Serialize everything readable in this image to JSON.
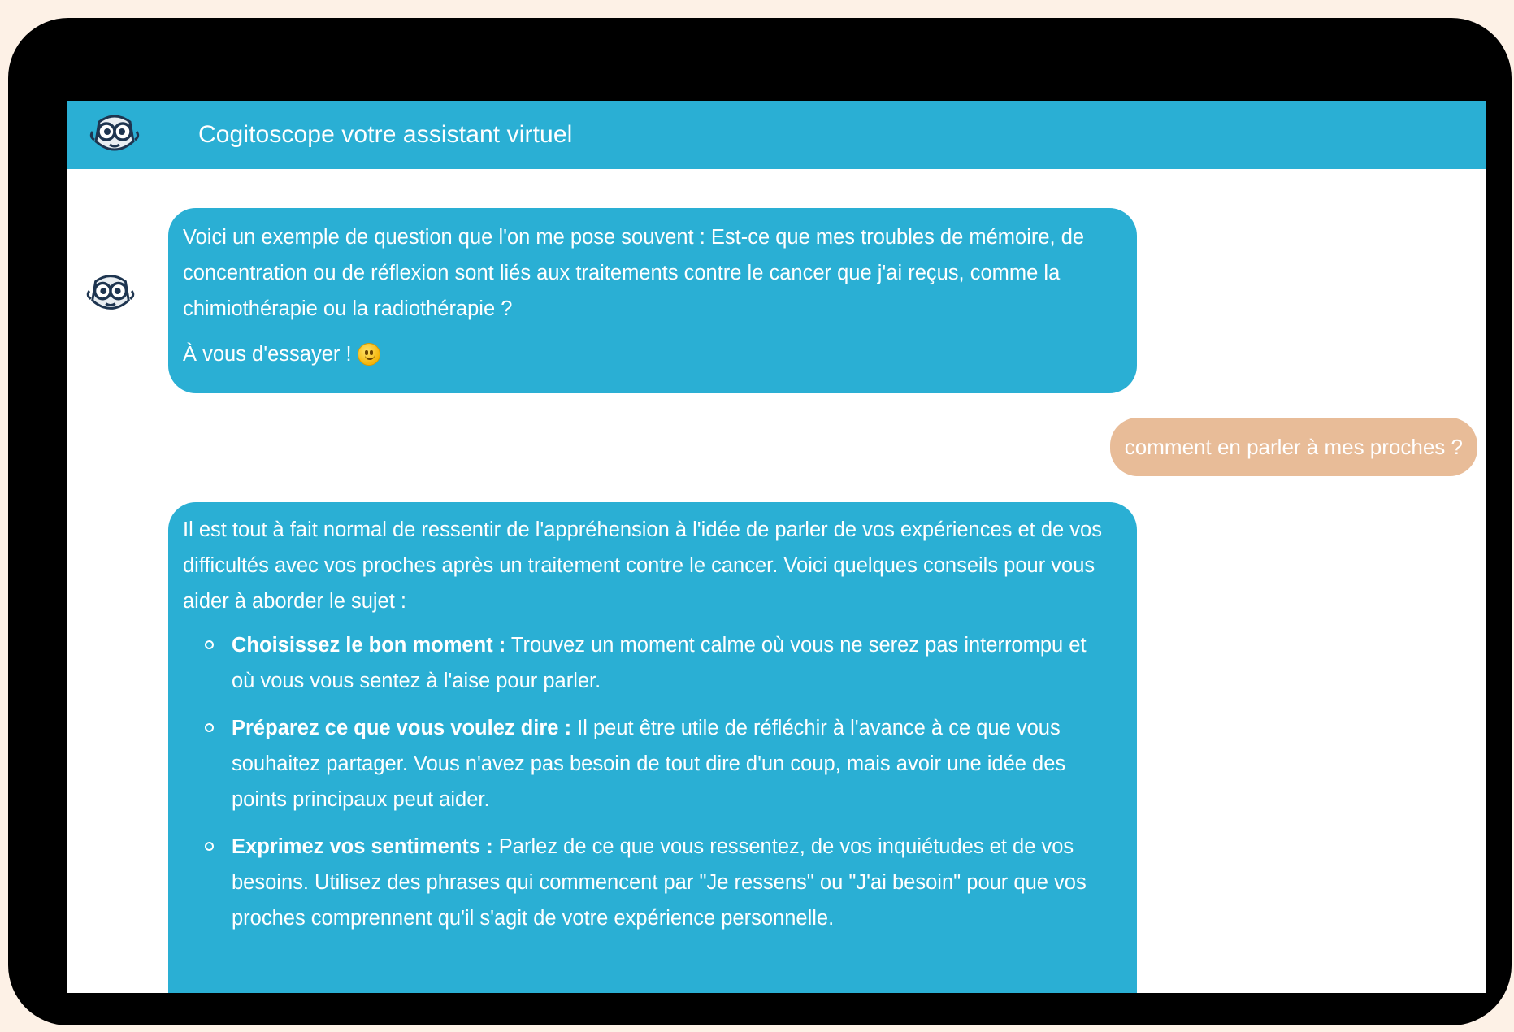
{
  "colors": {
    "page_background": "#fdf1e6",
    "device_frame": "#000000",
    "header_background": "#2aafd4",
    "bot_bubble": "#2aafd4",
    "user_bubble": "#e8bc98",
    "text_on_color": "#ffffff"
  },
  "header": {
    "title": "Cogitoscope votre assistant virtuel",
    "avatar_icon": "robot-owl-icon"
  },
  "messages": {
    "bot_intro": {
      "line1": "Voici un exemple de question que l'on me pose souvent : Est-ce que mes troubles de mémoire, de concentration ou de réflexion sont liés aux traitements contre le cancer que j'ai reçus, comme la chimiothérapie ou la radiothérapie ?",
      "line2": "À vous d'essayer !",
      "emoji": "smiley-icon"
    },
    "user_1": {
      "text": "comment en parler à mes proches ?"
    },
    "bot_reply": {
      "intro": "Il est tout à fait normal de ressentir de l'appréhension à l'idée de parler de vos expériences et de vos difficultés avec vos proches après un traitement contre le cancer. Voici quelques conseils pour vous aider à aborder le sujet :",
      "tips": [
        {
          "title": "Choisissez le bon moment :",
          "text": "Trouvez un moment calme où vous ne serez pas interrompu et où vous vous sentez à l'aise pour parler."
        },
        {
          "title": "Préparez ce que vous voulez dire :",
          "text": "Il peut être utile de réfléchir à l'avance à ce que vous souhaitez partager. Vous n'avez pas besoin de tout dire d'un coup, mais avoir une idée des points principaux peut aider."
        },
        {
          "title": "Exprimez vos sentiments :",
          "text": "Parlez de ce que vous ressentez, de vos inquiétudes et de vos besoins. Utilisez des phrases qui commencent par \"Je ressens\" ou \"J'ai besoin\" pour que vos proches comprennent qu'il s'agit de votre expérience personnelle."
        }
      ]
    }
  }
}
